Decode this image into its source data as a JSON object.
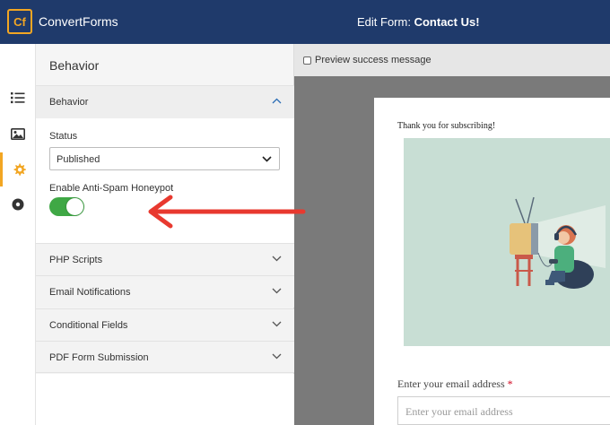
{
  "header": {
    "logo_text": "Cf",
    "brand": "ConvertForms",
    "edit_prefix": "Edit Form:",
    "form_name": "Contact Us!",
    "bg_color": "#1f3a6b",
    "accent_color": "#f2a623"
  },
  "rail": {
    "items": [
      {
        "icon": "list-icon",
        "active": false
      },
      {
        "icon": "image-icon",
        "active": false
      },
      {
        "icon": "gear-icon",
        "active": true
      },
      {
        "icon": "record-icon",
        "active": false
      }
    ]
  },
  "panel": {
    "title": "Behavior",
    "open_section": {
      "label": "Behavior",
      "status_label": "Status",
      "status_value": "Published",
      "honeypot_label": "Enable Anti-Spam Honeypot",
      "honeypot_enabled": true
    },
    "sections": [
      {
        "label": "PHP Scripts"
      },
      {
        "label": "Email Notifications"
      },
      {
        "label": "Conditional Fields"
      },
      {
        "label": "PDF Form Submission"
      }
    ]
  },
  "preview": {
    "checkbox_label": "Preview success message",
    "checked": false,
    "thanks_text": "Thank you for subscribing!",
    "email_label": "Enter your email address",
    "required_mark": "*",
    "email_placeholder": "Enter your email address"
  },
  "annotation": {
    "arrow_color": "#e8392f"
  }
}
